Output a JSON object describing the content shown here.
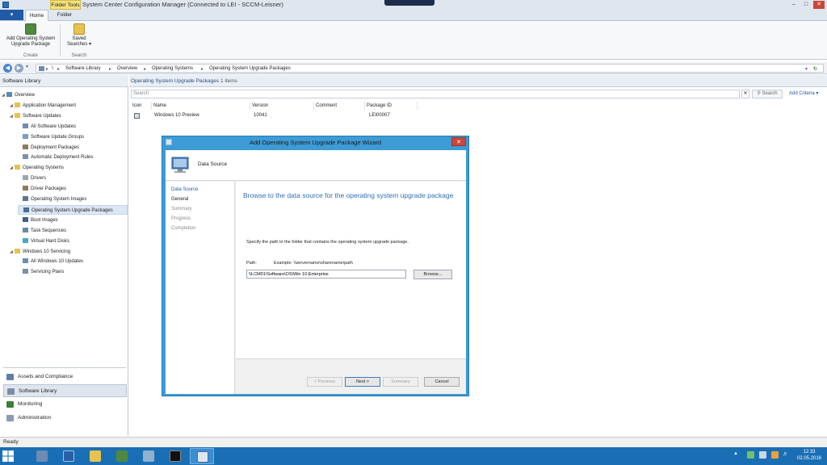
{
  "window": {
    "title": "System Center Configuration Manager (Connected to LEI - SCCM-Leisner)",
    "contextual_tab": "Folder Tools",
    "controls": {
      "minimize": "–",
      "maximize": "□",
      "close": "✕"
    }
  },
  "ribbon": {
    "file_tab": "▾",
    "tabs": [
      "Home",
      "Folder"
    ],
    "buttons": {
      "add_os_upgrade": "Add Operating System Upgrade Package",
      "saved_searches": "Saved Searches ▾"
    },
    "groups": {
      "create": "Create",
      "search": "Search"
    }
  },
  "address": {
    "root": "\\",
    "crumbs": [
      "Software Library",
      "Overview",
      "Operating Systems",
      "Operating System Upgrade Packages"
    ]
  },
  "nav": {
    "header": "Software Library",
    "tree": [
      {
        "label": "Overview",
        "level": 0,
        "icon": "overview-icon"
      },
      {
        "label": "Application Management",
        "level": 1,
        "icon": "folder-icon"
      },
      {
        "label": "Software Updates",
        "level": 1,
        "icon": "folder-icon"
      },
      {
        "label": "All Software Updates",
        "level": 2,
        "icon": "updates-icon"
      },
      {
        "label": "Software Update Groups",
        "level": 2,
        "icon": "update-group-icon"
      },
      {
        "label": "Deployment Packages",
        "level": 2,
        "icon": "package-icon"
      },
      {
        "label": "Automatic Deployment Rules",
        "level": 2,
        "icon": "rule-icon"
      },
      {
        "label": "Operating Systems",
        "level": 1,
        "icon": "folder-icon"
      },
      {
        "label": "Drivers",
        "level": 2,
        "icon": "driver-icon"
      },
      {
        "label": "Driver Packages",
        "level": 2,
        "icon": "package-icon"
      },
      {
        "label": "Operating System Images",
        "level": 2,
        "icon": "image-icon"
      },
      {
        "label": "Operating System Upgrade Packages",
        "level": 2,
        "icon": "upgrade-package-icon"
      },
      {
        "label": "Boot Images",
        "level": 2,
        "icon": "boot-image-icon"
      },
      {
        "label": "Task Sequences",
        "level": 2,
        "icon": "task-sequence-icon"
      },
      {
        "label": "Virtual Hard Disks",
        "level": 2,
        "icon": "disk-icon"
      },
      {
        "label": "Windows 10 Servicing",
        "level": 1,
        "icon": "folder-icon"
      },
      {
        "label": "All Windows 10 Updates",
        "level": 2,
        "icon": "updates-icon"
      },
      {
        "label": "Servicing Plans",
        "level": 2,
        "icon": "plan-icon"
      }
    ],
    "selected": "Operating System Upgrade Packages",
    "wunderbar": [
      "Assets and Compliance",
      "Software Library",
      "Monitoring",
      "Administration"
    ]
  },
  "main": {
    "header_title": "Operating System Upgrade Packages",
    "header_count": "1 items",
    "search_placeholder": "Search",
    "search_clear": "✕",
    "search_button": "Search",
    "add_criteria": "Add Criteria ▾",
    "columns": [
      "Icon",
      "Name",
      "Version",
      "Comment",
      "Package ID"
    ],
    "rows": [
      {
        "name": "Windows 10 Preview",
        "version": "10041",
        "comment": "",
        "package_id": "LEI00007"
      }
    ]
  },
  "wizard": {
    "title": "Add Operating System Upgrade Package Wizard",
    "close": "✕",
    "banner_title": "Data Source",
    "steps": [
      "Data Source",
      "General",
      "Summary",
      "Progress",
      "Completion"
    ],
    "current_step": "Data Source",
    "heading": "Browse to the data source for the operating system upgrade package",
    "description": "Specify the path to the folder that contains the operating system upgrade package.",
    "path_label": "Path:",
    "path_example": "Example: \\\\servername\\sharename\\path",
    "path_value": "\\\\LCM01\\Software\\OS\\Win 10 Enterprise",
    "browse": "Browse...",
    "buttons": {
      "previous": "< Previous",
      "next": "Next >",
      "summary": "Summary",
      "cancel": "Cancel"
    }
  },
  "status": {
    "text": "Ready"
  },
  "taskbar": {
    "time": "12:33",
    "date": "02.05.2016"
  },
  "colors": {
    "accent": "#1f5aa6",
    "dialog_frame": "#3d9bd6",
    "taskbar": "#1a6fb4",
    "close": "#c9473b"
  }
}
